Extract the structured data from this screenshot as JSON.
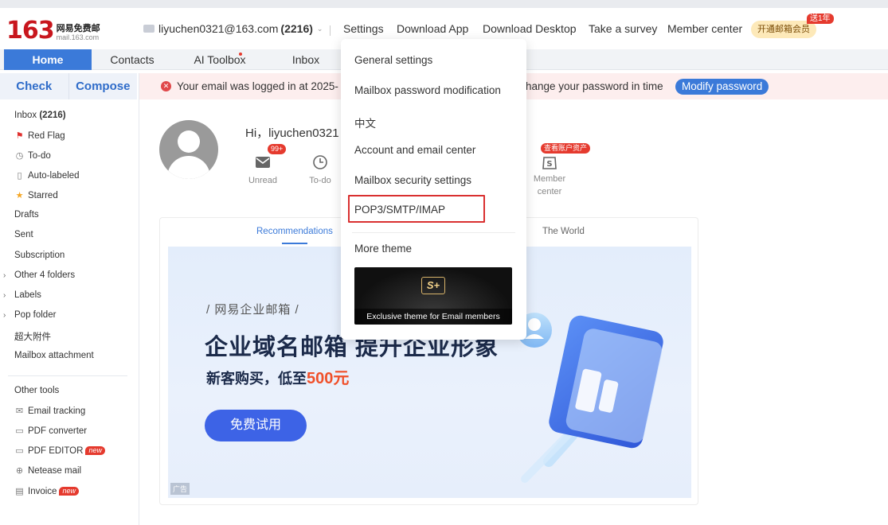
{
  "header": {
    "logo_number": "163",
    "logo_name": "网易免费邮",
    "logo_domain": "mail.163.com",
    "account_email": "liyuchen0321@163.com",
    "account_count": "(2216)",
    "nav": [
      "Settings",
      "Download App",
      "Download Desktop",
      "Take a survey",
      "Member center"
    ],
    "vip_button": "开通邮箱会员",
    "vip_tag": "送1年"
  },
  "tabs": [
    "Home",
    "Contacts",
    "AI Toolbox",
    "Inbox"
  ],
  "sidebar": {
    "check": "Check",
    "compose": "Compose",
    "items": [
      {
        "label": "Inbox",
        "count": "(2216)"
      },
      {
        "label": "Red Flag"
      },
      {
        "label": "To-do"
      },
      {
        "label": "Auto-labeled"
      },
      {
        "label": "Starred"
      },
      {
        "label": "Drafts"
      },
      {
        "label": "Sent"
      },
      {
        "label": "Subscription"
      },
      {
        "label": "Other 4 folders"
      },
      {
        "label": "Labels"
      },
      {
        "label": "Pop folder"
      },
      {
        "label": "超大附件"
      },
      {
        "label": "Mailbox attachment"
      }
    ],
    "tools_title": "Other tools",
    "tools": [
      {
        "label": "Email tracking"
      },
      {
        "label": "PDF converter"
      },
      {
        "label": "PDF EDITOR",
        "badge": "new"
      },
      {
        "label": "Netease mail"
      },
      {
        "label": "Invoice",
        "badge": "new"
      }
    ]
  },
  "alert": {
    "text_left": "Your email was logged in at 2025-",
    "text_right": "hange your password in time",
    "button": "Modify password"
  },
  "greeting": {
    "text": "Hi，liyuchen0321",
    "stats": [
      {
        "label": "Unread",
        "badge": "99+"
      },
      {
        "label": "To-do"
      },
      {
        "label": "Member center",
        "badge": "查看账户资产"
      }
    ]
  },
  "content": {
    "tabs": [
      "Recommendations",
      "The World"
    ],
    "banner": {
      "subtitle": "/ 网易企业邮箱 /",
      "title": "企业域名邮箱 提升企业形象",
      "price_prefix": "新客购买，低至",
      "price_value": "500元",
      "button": "免费试用",
      "ad_label": "广告"
    }
  },
  "settings_menu": {
    "items": [
      "General settings",
      "Mailbox password modification",
      "中文",
      "Account and email center",
      "Mailbox security settings",
      "POP3/SMTP/IMAP",
      "More theme"
    ],
    "theme_caption": "Exclusive theme for Email members",
    "theme_logo": "S+"
  },
  "colors": {
    "brand_red": "#c8161d",
    "accent_blue": "#3b7ad9",
    "highlight_red": "#d93030"
  }
}
